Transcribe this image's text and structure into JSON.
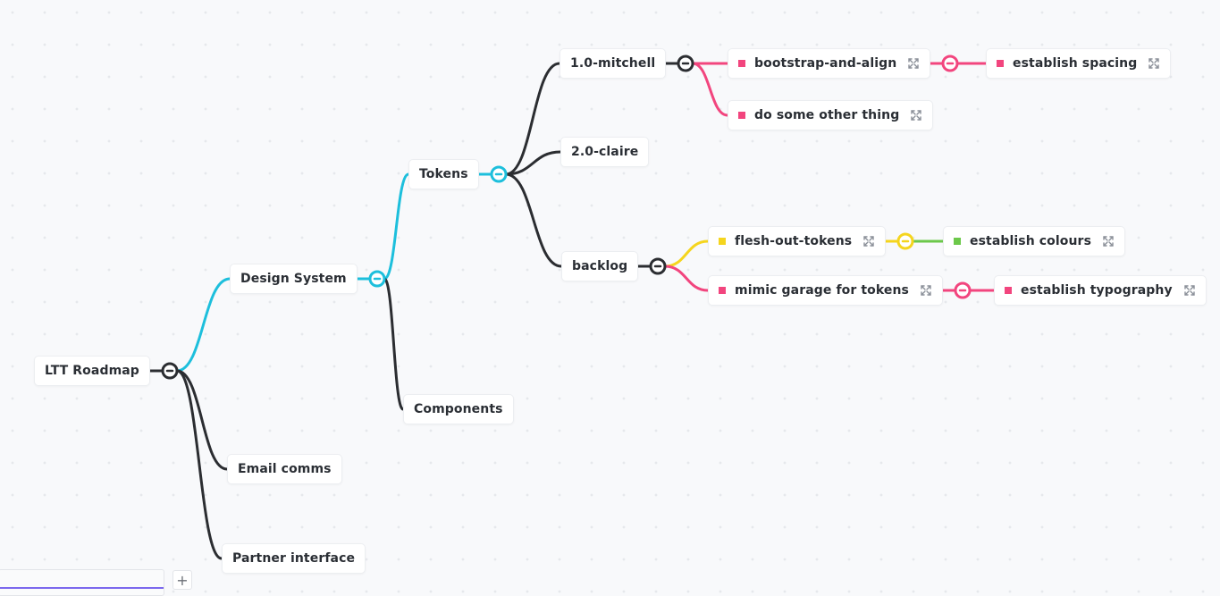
{
  "mindmap": {
    "colors": {
      "dark": "#2b2d31",
      "cyan": "#1dbfdc",
      "pink": "#f2457e",
      "yellow": "#f5d51e",
      "green": "#6cc84a",
      "expand_icon": "#8a8f98"
    },
    "nodes": {
      "root": {
        "label": "LTT Roadmap"
      },
      "design_system": {
        "label": "Design System"
      },
      "email_comms": {
        "label": "Email comms"
      },
      "partner_interface": {
        "label": "Partner interface"
      },
      "tokens": {
        "label": "Tokens"
      },
      "components": {
        "label": "Components"
      },
      "mitchell": {
        "label": "1.0-mitchell"
      },
      "claire": {
        "label": "2.0-claire"
      },
      "backlog": {
        "label": "backlog"
      },
      "bootstrap": {
        "label": "bootstrap-and-align",
        "status_color": "pink",
        "icon": "expand-icon"
      },
      "other_thing": {
        "label": "do some other thing",
        "status_color": "pink",
        "icon": "expand-icon"
      },
      "spacing": {
        "label": "establish spacing",
        "status_color": "pink",
        "icon": "expand-icon"
      },
      "flesh_out": {
        "label": "flesh-out-tokens",
        "status_color": "yellow",
        "icon": "expand-icon"
      },
      "colours": {
        "label": "establish colours",
        "status_color": "green",
        "icon": "expand-icon"
      },
      "mimic": {
        "label": "mimic garage for tokens",
        "status_color": "pink",
        "icon": "expand-icon"
      },
      "typography": {
        "label": "establish typography",
        "status_color": "pink",
        "icon": "expand-icon"
      }
    },
    "edges": [
      {
        "from": "root",
        "to": "design_system",
        "color": "cyan"
      },
      {
        "from": "root",
        "to": "email_comms",
        "color": "dark"
      },
      {
        "from": "root",
        "to": "partner_interface",
        "color": "dark"
      },
      {
        "from": "design_system",
        "to": "tokens",
        "color": "cyan"
      },
      {
        "from": "design_system",
        "to": "components",
        "color": "dark"
      },
      {
        "from": "tokens",
        "to": "mitchell",
        "color": "dark"
      },
      {
        "from": "tokens",
        "to": "claire",
        "color": "dark"
      },
      {
        "from": "tokens",
        "to": "backlog",
        "color": "dark"
      },
      {
        "from": "mitchell",
        "to": "bootstrap",
        "color": "pink"
      },
      {
        "from": "mitchell",
        "to": "other_thing",
        "color": "pink"
      },
      {
        "from": "bootstrap",
        "to": "spacing",
        "color": "pink"
      },
      {
        "from": "backlog",
        "to": "flesh_out",
        "color": "yellow"
      },
      {
        "from": "backlog",
        "to": "mimic",
        "color": "pink"
      },
      {
        "from": "flesh_out",
        "to": "colours",
        "color": "green"
      },
      {
        "from": "mimic",
        "to": "typography",
        "color": "pink"
      }
    ],
    "collapse_toggles": [
      {
        "node": "root",
        "color": "dark",
        "icon": "collapse-icon"
      },
      {
        "node": "design_system",
        "color": "cyan",
        "icon": "collapse-icon"
      },
      {
        "node": "tokens",
        "color": "cyan",
        "icon": "collapse-icon"
      },
      {
        "node": "mitchell",
        "color": "dark",
        "icon": "collapse-icon"
      },
      {
        "node": "bootstrap",
        "color": "pink",
        "icon": "collapse-icon"
      },
      {
        "node": "backlog",
        "color": "dark",
        "icon": "collapse-icon"
      },
      {
        "node": "flesh_out",
        "color": "yellow",
        "icon": "collapse-icon"
      },
      {
        "node": "mimic",
        "color": "pink",
        "icon": "collapse-icon"
      }
    ]
  },
  "footer": {
    "add_button_label": "+"
  }
}
